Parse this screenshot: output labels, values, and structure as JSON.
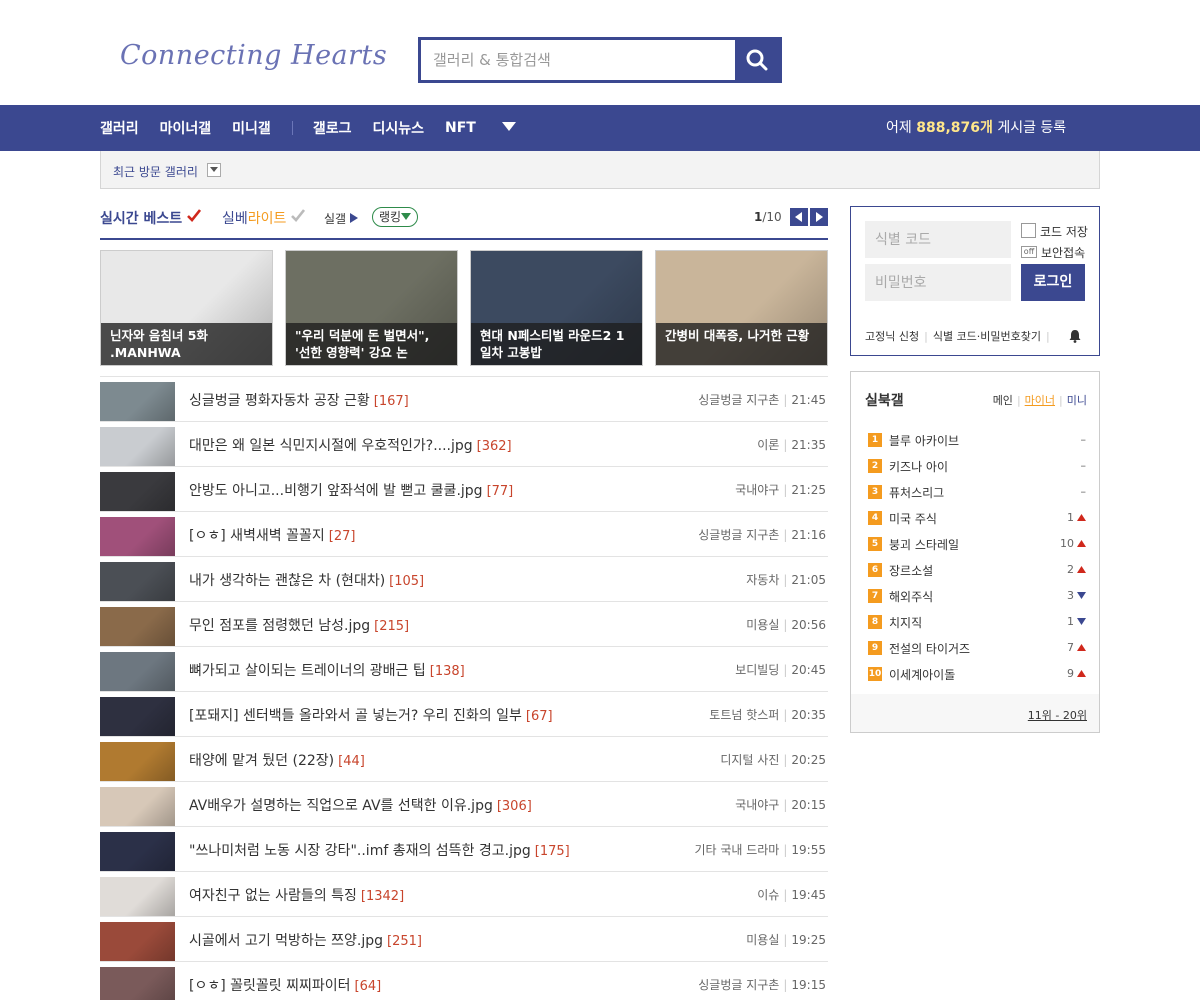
{
  "header": {
    "logo": "Connecting Hearts",
    "search_placeholder": "갤러리 & 통합검색"
  },
  "nav": {
    "items": [
      "갤러리",
      "마이너갤",
      "미니갤",
      "갤로그",
      "디시뉴스",
      "NFT"
    ],
    "stat_prefix": "어제 ",
    "stat_value": "888,876개",
    "stat_suffix": " 게시글 등록"
  },
  "recent": {
    "label": "최근 방문 갤러리"
  },
  "tabs": {
    "realtime": "실시간 베스트",
    "silbe": "실베",
    "lite": "라이트",
    "silgal": "실갤",
    "ranking": "랭킹",
    "page_current": "1",
    "page_total": "/10"
  },
  "thumbs": [
    {
      "caption": "닌자와 음침녀 5화 .MANHWA",
      "color": "#e8e8e8"
    },
    {
      "caption": "\"우리 덕분에 돈 벌면서\", '선한 영향력' 강요 논",
      "color": "#6d6f62"
    },
    {
      "caption": "현대 N페스티벌 라운드2 1일차 고봉밥",
      "color": "#3c4a60"
    },
    {
      "caption": "간병비 대폭증, 나거한 근황",
      "color": "#c9b59a"
    }
  ],
  "posts": [
    {
      "title": "싱글벙글 평화자동차 공장 근황",
      "count": "[167]",
      "gallery": "싱글벙글 지구촌",
      "time": "21:45",
      "color": "#7d8a90"
    },
    {
      "title": "대만은 왜 일본 식민지시절에 우호적인가?....jpg",
      "count": "[362]",
      "gallery": "이론",
      "time": "21:35",
      "color": "#c9ccd0"
    },
    {
      "title": "안방도 아니고...비행기 앞좌석에 발 뻗고 쿨쿨.jpg",
      "count": "[77]",
      "gallery": "국내야구",
      "time": "21:25",
      "color": "#3a3a3e"
    },
    {
      "title": "[ㅇㅎ] 새벽새벽 꼴꼴지",
      "count": "[27]",
      "gallery": "싱글벙글 지구촌",
      "time": "21:16",
      "color": "#a0507a"
    },
    {
      "title": "내가 생각하는 괜찮은 차 (현대차)",
      "count": "[105]",
      "gallery": "자동차",
      "time": "21:05",
      "color": "#4b4f55"
    },
    {
      "title": "무인 점포를 점령했던 남성.jpg",
      "count": "[215]",
      "gallery": "미용실",
      "time": "20:56",
      "color": "#8a6a4a"
    },
    {
      "title": "뼈가되고 살이되는 트레이너의 광배근 팁",
      "count": "[138]",
      "gallery": "보디빌딩",
      "time": "20:45",
      "color": "#6d7780"
    },
    {
      "title": "[포돼지] 센터백들 올라와서 골 넣는거? 우리 진화의 일부",
      "count": "[67]",
      "gallery": "토트넘 핫스퍼",
      "time": "20:35",
      "color": "#2e3040"
    },
    {
      "title": "태양에 맡겨 뒀던 (22장)",
      "count": "[44]",
      "gallery": "디지털 사진",
      "time": "20:25",
      "color": "#b07a30"
    },
    {
      "title": "AV배우가 설명하는 직업으로 AV를 선택한 이유.jpg",
      "count": "[306]",
      "gallery": "국내야구",
      "time": "20:15",
      "color": "#d7c8b8"
    },
    {
      "title": "\"쓰나미처럼 노동 시장 강타\"..imf 총재의 섬뜩한 경고.jpg",
      "count": "[175]",
      "gallery": "기타 국내 드라마",
      "time": "19:55",
      "color": "#2b3048"
    },
    {
      "title": "여자친구 없는 사람들의 특징",
      "count": "[1342]",
      "gallery": "이슈",
      "time": "19:45",
      "color": "#e0dcd8"
    },
    {
      "title": "시골에서 고기 먹방하는 쯔양.jpg",
      "count": "[251]",
      "gallery": "미용실",
      "time": "19:25",
      "color": "#9a4a3a"
    },
    {
      "title": "[ㅇㅎ] 꼴릿꼴릿 찌찌파이터",
      "count": "[64]",
      "gallery": "싱글벙글 지구촌",
      "time": "19:15",
      "color": "#7a5a5a"
    }
  ],
  "login": {
    "id_placeholder": "식별 코드",
    "pw_placeholder": "비밀번호",
    "save_code": "코드 저장",
    "off": "off",
    "secure": "보안접속",
    "button": "로그인",
    "signup": "고정닉 신청",
    "find": "식별 코드·비밀번호찾기"
  },
  "ranking": {
    "title": "실북갤",
    "tab_main": "메인",
    "tab_minor": "마이너",
    "tab_mini": "미니",
    "items": [
      {
        "rank": "1",
        "name": "블루 아카이브",
        "change": "–",
        "dir": "none"
      },
      {
        "rank": "2",
        "name": "키즈나 아이",
        "change": "–",
        "dir": "none"
      },
      {
        "rank": "3",
        "name": "퓨처스리그",
        "change": "–",
        "dir": "none"
      },
      {
        "rank": "4",
        "name": "미국 주식",
        "change": "1",
        "dir": "up"
      },
      {
        "rank": "5",
        "name": "붕괴 스타레일",
        "change": "10",
        "dir": "up"
      },
      {
        "rank": "6",
        "name": "장르소설",
        "change": "2",
        "dir": "up"
      },
      {
        "rank": "7",
        "name": "해외주식",
        "change": "3",
        "dir": "down"
      },
      {
        "rank": "8",
        "name": "치지직",
        "change": "1",
        "dir": "down"
      },
      {
        "rank": "9",
        "name": "전설의 타이거즈",
        "change": "7",
        "dir": "up"
      },
      {
        "rank": "10",
        "name": "이세계아이돌",
        "change": "9",
        "dir": "up"
      }
    ],
    "more": "11위 - 20위"
  },
  "colors": {
    "brand": "#3b4890",
    "accent": "#f49b1f",
    "count_red": "#c8452c"
  }
}
